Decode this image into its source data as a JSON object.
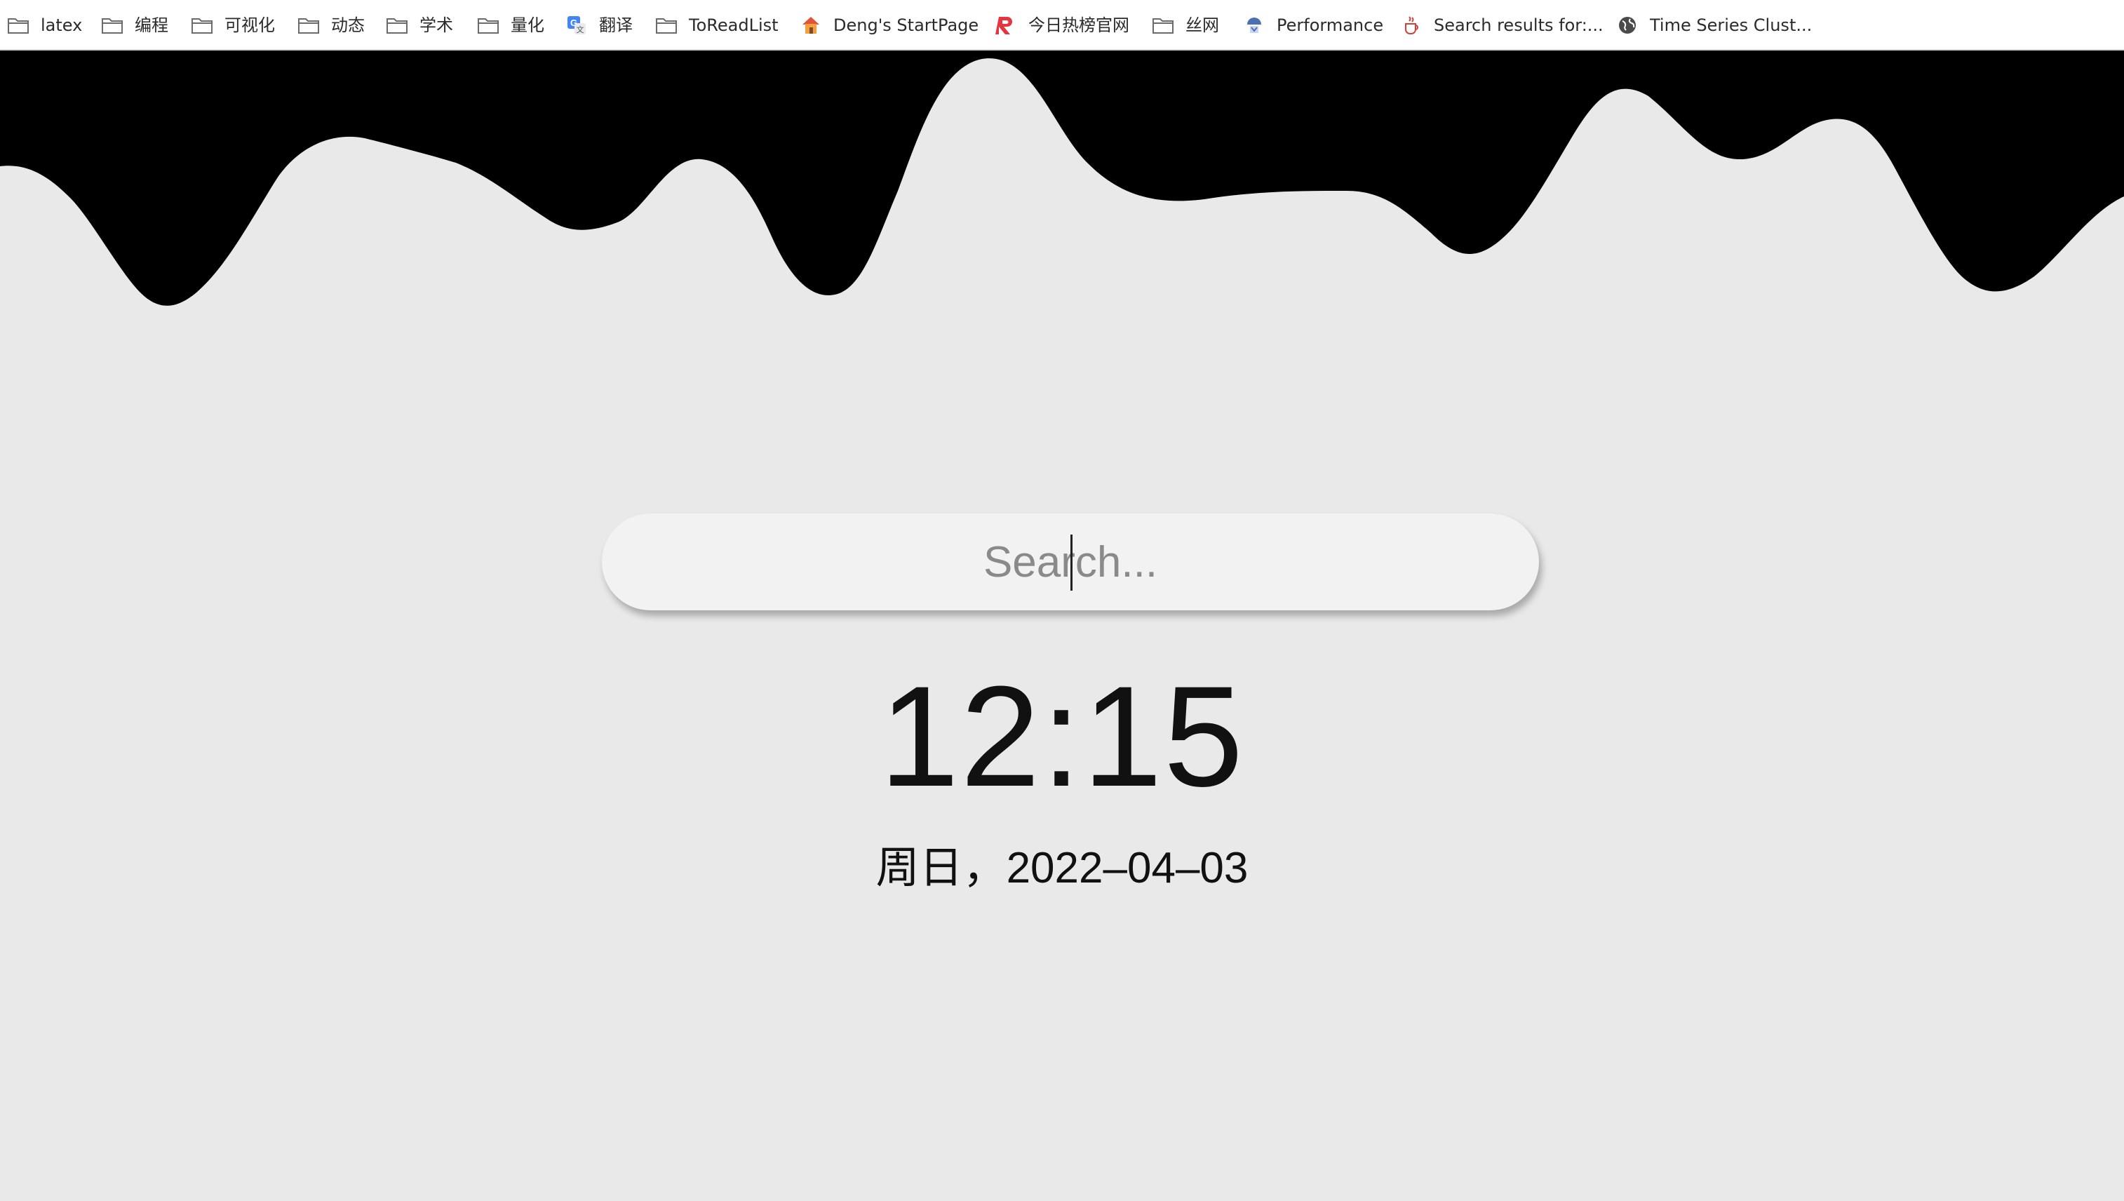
{
  "bookmarks": [
    {
      "label": "latex",
      "icon": "folder-icon"
    },
    {
      "label": "编程",
      "icon": "folder-icon"
    },
    {
      "label": "可视化",
      "icon": "folder-icon"
    },
    {
      "label": "动态",
      "icon": "folder-icon"
    },
    {
      "label": "学术",
      "icon": "folder-icon"
    },
    {
      "label": "量化",
      "icon": "folder-icon"
    },
    {
      "label": "翻译",
      "icon": "google-translate-icon"
    },
    {
      "label": "ToReadList",
      "icon": "folder-icon"
    },
    {
      "label": "Deng's StartPage",
      "icon": "house-icon"
    },
    {
      "label": "今日热榜官网",
      "icon": "red-r-logo-icon"
    },
    {
      "label": "丝网",
      "icon": "folder-icon"
    },
    {
      "label": "Performance",
      "icon": "performance-icon"
    },
    {
      "label": "Search results for:...",
      "icon": "java-cup-icon"
    },
    {
      "label": "Time Series Clust...",
      "icon": "globe-icon"
    }
  ],
  "search": {
    "placeholder": "Search..."
  },
  "clock": {
    "time": "12:15",
    "date": "周日，2022–04–03"
  },
  "colors": {
    "background": "#e9e9e9",
    "wave": "#000000",
    "search_bg": "#f2f2f2"
  }
}
